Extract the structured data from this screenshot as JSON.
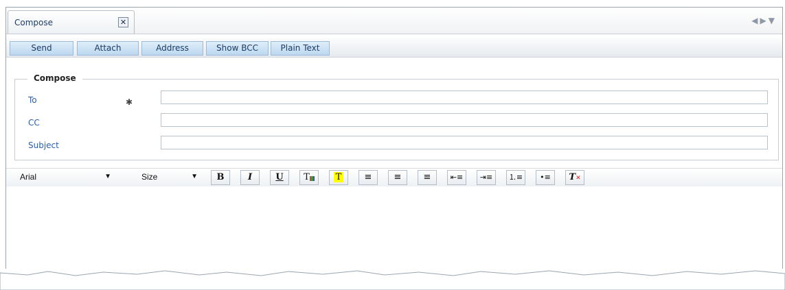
{
  "tab": {
    "label": "Compose",
    "close_icon": "close-icon"
  },
  "tab_nav": {
    "left": "◀",
    "right": "▶",
    "menu": "▼"
  },
  "toolbar": {
    "buttons": [
      "Send",
      "Attach",
      "Address",
      "Show BCC",
      "Plain Text"
    ]
  },
  "form": {
    "legend": "Compose",
    "to_label": "To",
    "required_mark": "✱",
    "cc_label": "CC",
    "subject_label": "Subject",
    "to_value": "",
    "cc_value": "",
    "subject_value": ""
  },
  "editor_toolbar": {
    "font": "Arial",
    "size": "Size",
    "bold": "B",
    "italic": "I",
    "underline": "U",
    "text_color": "T",
    "highlight": "T",
    "clear_format": "T"
  },
  "colors": {
    "accent": "#2a5db0",
    "button_bg": "#bcd8ef",
    "highlight": "#ffff00"
  }
}
